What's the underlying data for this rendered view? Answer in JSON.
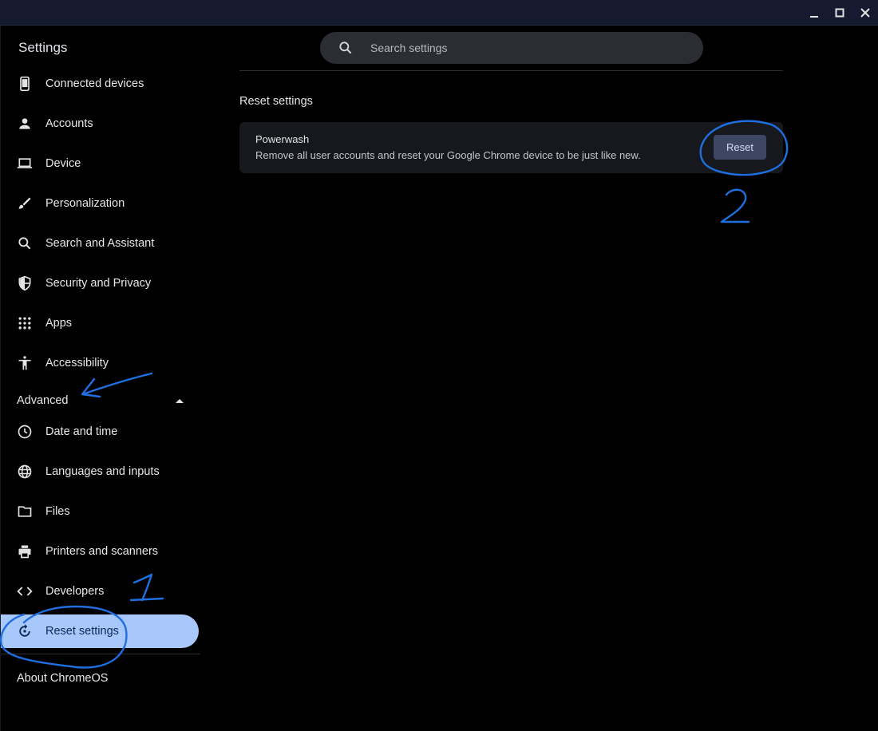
{
  "window": {
    "controls": [
      "minimize-icon",
      "maximize-icon",
      "close-icon"
    ]
  },
  "app": {
    "title": "Settings"
  },
  "search": {
    "placeholder": "Search settings",
    "icon": "search-icon"
  },
  "sidebar": {
    "items": [
      {
        "label": "Connected devices",
        "icon": "phone-icon"
      },
      {
        "label": "Accounts",
        "icon": "person-icon"
      },
      {
        "label": "Device",
        "icon": "laptop-icon"
      },
      {
        "label": "Personalization",
        "icon": "brush-icon"
      },
      {
        "label": "Search and Assistant",
        "icon": "search-icon"
      },
      {
        "label": "Security and Privacy",
        "icon": "shield-icon"
      },
      {
        "label": "Apps",
        "icon": "apps-grid-icon"
      },
      {
        "label": "Accessibility",
        "icon": "accessibility-icon"
      }
    ],
    "advanced": {
      "label": "Advanced",
      "expanded": true,
      "items": [
        {
          "label": "Date and time",
          "icon": "clock-icon"
        },
        {
          "label": "Languages and inputs",
          "icon": "globe-icon"
        },
        {
          "label": "Files",
          "icon": "folder-icon"
        },
        {
          "label": "Printers and scanners",
          "icon": "printer-icon"
        },
        {
          "label": "Developers",
          "icon": "code-icon"
        },
        {
          "label": "Reset settings",
          "icon": "reset-icon",
          "active": true
        }
      ]
    },
    "about": {
      "label": "About ChromeOS"
    }
  },
  "main": {
    "title": "Reset settings",
    "powerwash": {
      "title": "Powerwash",
      "description": "Remove all user accounts and reset your Google Chrome device to be just like new.",
      "button_label": "Reset"
    }
  },
  "annotations": {
    "step_1": "1",
    "step_2": "2"
  },
  "colors": {
    "active_nav": "#a8c7fa",
    "annotation_ink": "#1f6fe0",
    "button_bg": "#3d4663"
  }
}
